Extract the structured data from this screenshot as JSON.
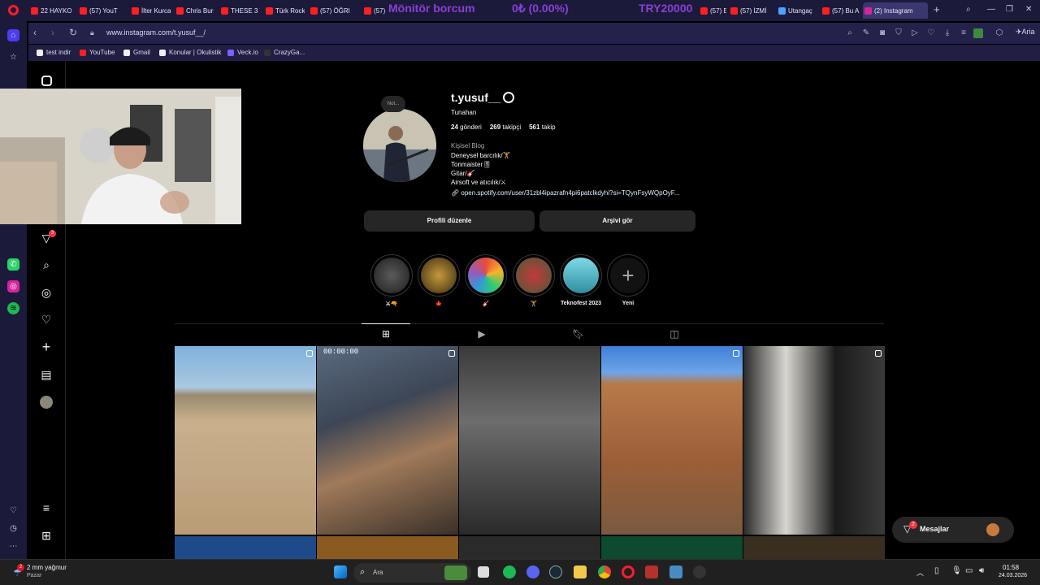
{
  "browser": {
    "tabs": [
      {
        "label": "22 HAYKO"
      },
      {
        "label": "(57) YouT"
      },
      {
        "label": "İlter Kurca"
      },
      {
        "label": "Chris Burn"
      },
      {
        "label": "THESE 3 V"
      },
      {
        "label": "Türk Rock"
      },
      {
        "label": "(57) ÖĞRE"
      },
      {
        "label": "(57)"
      },
      {
        "label": "(57) Eski S"
      },
      {
        "label": "(57) İZMİ"
      },
      {
        "label": "Utangaç"
      },
      {
        "label": "(57) Bu A"
      },
      {
        "label": "(2) Instagram"
      }
    ],
    "ticker": {
      "name": "Mönitör borcum",
      "percent": "0₺ (0.00%)",
      "target": "TRY20000"
    },
    "url": "www.instagram.com/t.yusuf__/",
    "aria_label": "Aria",
    "bookmarks": [
      {
        "label": "test indir"
      },
      {
        "label": "YouTube"
      },
      {
        "label": "Gmail"
      },
      {
        "label": "Konular | Okulistik"
      },
      {
        "label": "Veck.io"
      },
      {
        "label": "CrazyGa..."
      }
    ]
  },
  "profile": {
    "username": "t.yusuf__",
    "note": "Not...",
    "full_name": "Tunahan",
    "posts_count": "24",
    "posts_label": "gönderi",
    "followers_count": "269",
    "followers_label": "takipçi",
    "following_count": "561",
    "following_label": "takip",
    "category": "Kişisel Blog",
    "bio_lines": [
      "Deneysel barcılık/🏋",
      "Tonmaister🎚",
      "Gitar/🎸",
      "Airsoft ve atıcılık/⚔"
    ],
    "link": "open.spotify.com/user/31zbl4ipazrafn4pi6patclkdyhi?si=TQynFsyWQpOyF...",
    "edit_profile_label": "Profili düzenle",
    "archive_label": "Arşivi gör"
  },
  "highlights": [
    {
      "label": "⚔🔫"
    },
    {
      "label": "🍁"
    },
    {
      "label": "🎸"
    },
    {
      "label": "🏋"
    },
    {
      "label": "Teknofest 2023"
    },
    {
      "label": "Yeni"
    }
  ],
  "posts": [
    {
      "overlay": ""
    },
    {
      "overlay": "00:00:00"
    },
    {
      "overlay": ""
    },
    {
      "overlay": ""
    },
    {
      "overlay": ""
    }
  ],
  "messages": {
    "label": "Mesajlar",
    "badge": "2"
  },
  "rail": {
    "notif_badge": "3"
  },
  "taskbar": {
    "weather_temp": "2 mm yağmur",
    "weather_day": "Pazar",
    "weather_badge": "2",
    "search_placeholder": "Ara",
    "time": "01:58",
    "date": "24.03.2026"
  },
  "colors": {
    "opera_red": "#ff1b2d",
    "chrome_bg": "#1c1a3b",
    "ticker_purple": "#8a3fd6",
    "ig_surface": "#262626",
    "notification_red": "#ff3040"
  }
}
